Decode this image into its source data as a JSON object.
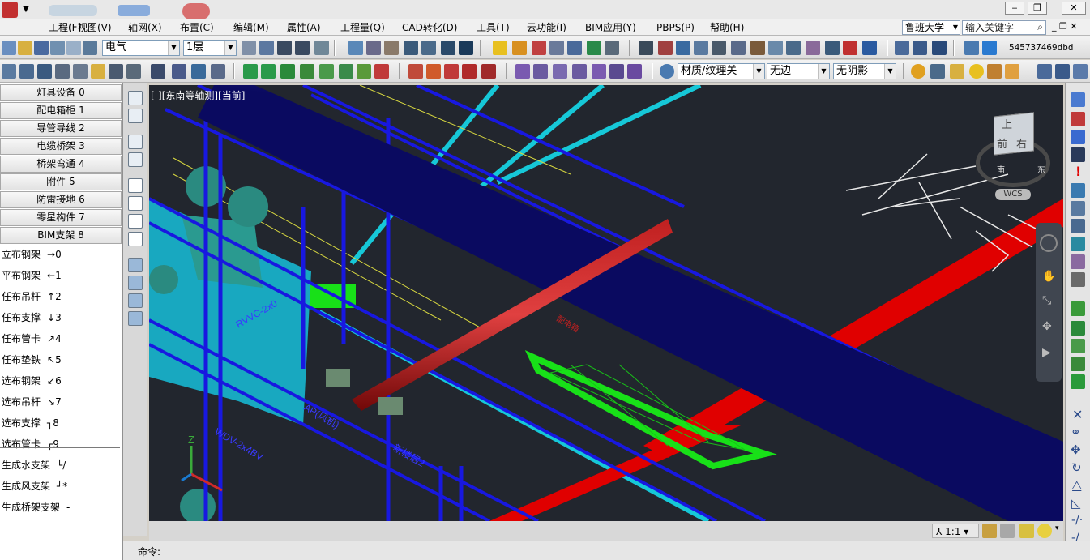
{
  "menu": {
    "items": [
      "工程(F)",
      "视图(V)",
      "轴网(X)",
      "布置(C)",
      "编辑(M)",
      "属性(A)",
      "工程量(Q)",
      "CAD转化(D)",
      "工具(T)",
      "云功能(I)",
      "BIM应用(Y)",
      "PBPS(P)",
      "帮助(H)"
    ],
    "user": "鲁班大学",
    "search_placeholder": "输入关键字"
  },
  "toolbar": {
    "discipline": "电气",
    "floor": "1层",
    "material_mode": "材质/纹理关",
    "edge_mode": "无边",
    "shadow_mode": "无阴影",
    "account_id": "545737469dbd"
  },
  "categories": [
    {
      "label": "灯具设备 0"
    },
    {
      "label": "配电箱柜 1"
    },
    {
      "label": "导管导线 2"
    },
    {
      "label": "电缆桥架 3"
    },
    {
      "label": "桥架弯通 4"
    },
    {
      "label": "附件 5"
    },
    {
      "label": "防雷接地 6"
    },
    {
      "label": "零星构件 7"
    },
    {
      "label": "BIM支架 8"
    }
  ],
  "commands": [
    {
      "label": "立布钢架",
      "key": "→0"
    },
    {
      "label": "平布钢架",
      "key": "←1"
    },
    {
      "label": "任布吊杆",
      "key": "↑2"
    },
    {
      "label": "任布支撑",
      "key": "↓3"
    },
    {
      "label": "任布管卡",
      "key": "↗4"
    },
    {
      "label": "任布垫铁",
      "key": "↖5"
    },
    {
      "label": "选布钢架",
      "key": "↙6"
    },
    {
      "label": "选布吊杆",
      "key": "↘7"
    },
    {
      "label": "选布支撑",
      "key": "┐8"
    },
    {
      "label": "选布管卡",
      "key": "┌9"
    },
    {
      "label": "生成水支架",
      "key": "└/"
    },
    {
      "label": "生成风支架",
      "key": "┘*"
    },
    {
      "label": "生成桥架支架",
      "key": "-"
    }
  ],
  "viewport": {
    "label": "[-][东南等轴测][当前]",
    "viewcube": {
      "top": "上",
      "front": "前",
      "right": "右",
      "south": "南",
      "east": "东",
      "wcs": "WCS"
    },
    "cad_labels": [
      "新楼层2",
      "AP(风机)",
      "WDV-2x4BV",
      "RVVC-2x0",
      "配电箱"
    ],
    "axis_z": "Z"
  },
  "status": {
    "scale": "1:1"
  },
  "command_line": {
    "prompt": "命令:"
  },
  "colors": {
    "viewport_bg": "#22262e",
    "pipe_blue": "#1818e0",
    "cyan": "#16c8d8",
    "red": "#e00000",
    "green": "#18e018",
    "teal": "#2a8a80"
  }
}
